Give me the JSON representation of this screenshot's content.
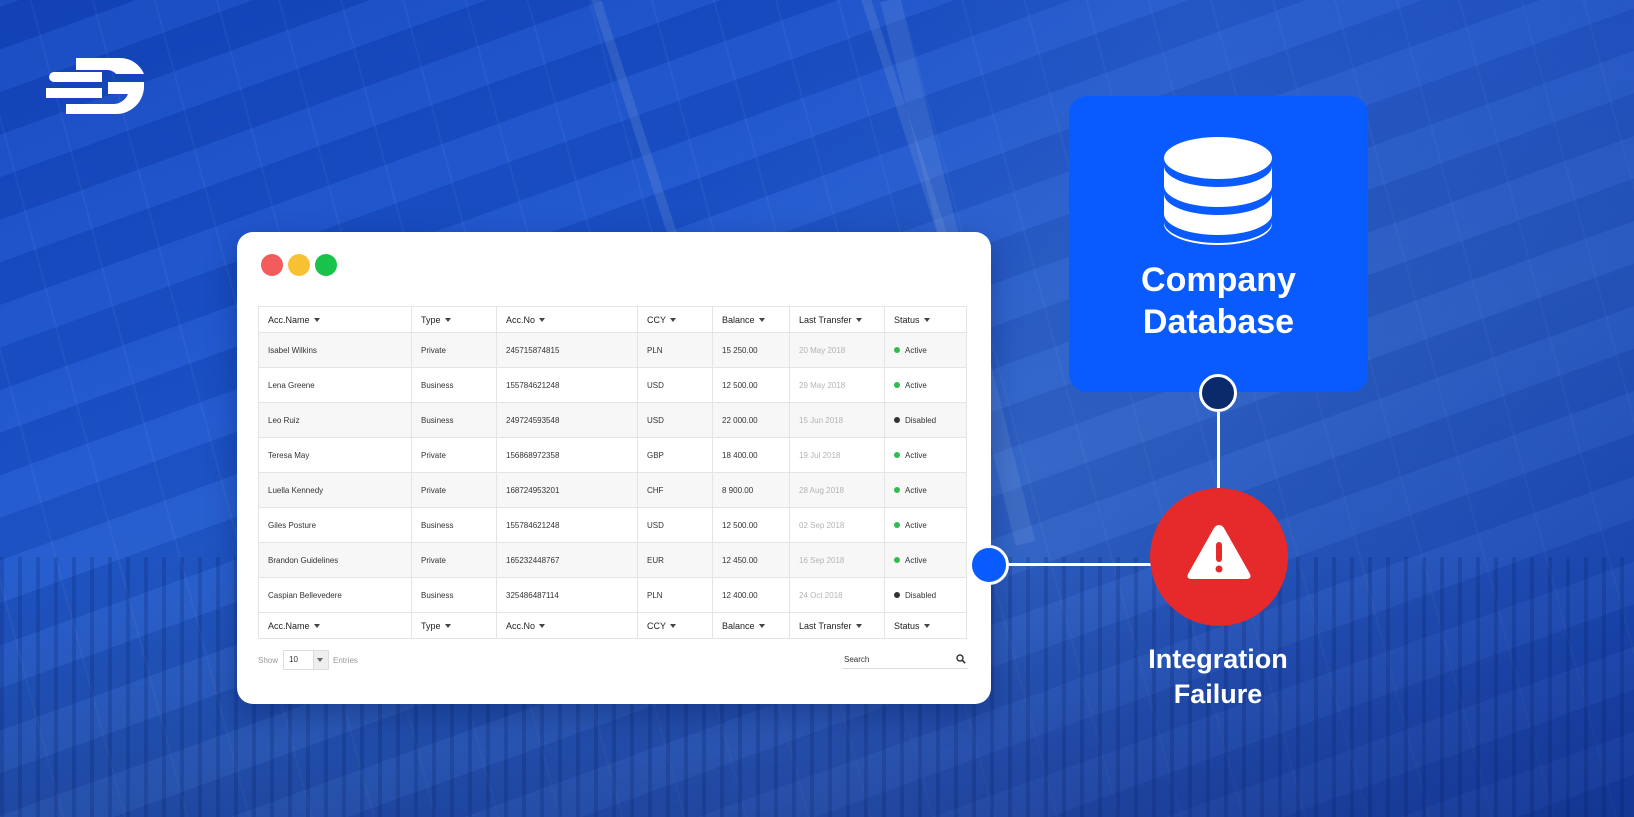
{
  "table": {
    "columns": [
      "Acc.Name",
      "Type",
      "Acc.No",
      "CCY",
      "Balance",
      "Last Transfer",
      "Status"
    ],
    "rows": [
      {
        "name": "Isabel Wilkins",
        "type": "Private",
        "acc_no": "245715874815",
        "ccy": "PLN",
        "balance": "15 250.00",
        "last_transfer": "20 May 2018",
        "status": "Active"
      },
      {
        "name": "Lena Greene",
        "type": "Business",
        "acc_no": "155784621248",
        "ccy": "USD",
        "balance": "12 500.00",
        "last_transfer": "29 May 2018",
        "status": "Active"
      },
      {
        "name": "Leo Ruiz",
        "type": "Business",
        "acc_no": "249724593548",
        "ccy": "USD",
        "balance": "22 000.00",
        "last_transfer": "15 Jun 2018",
        "status": "Disabled"
      },
      {
        "name": "Teresa May",
        "type": "Private",
        "acc_no": "156868972358",
        "ccy": "GBP",
        "balance": "18 400.00",
        "last_transfer": "19 Jul 2018",
        "status": "Active"
      },
      {
        "name": "Luella Kennedy",
        "type": "Private",
        "acc_no": "168724953201",
        "ccy": "CHF",
        "balance": "8 900.00",
        "last_transfer": "28 Aug 2018",
        "status": "Active"
      },
      {
        "name": "Giles Posture",
        "type": "Business",
        "acc_no": "155784621248",
        "ccy": "USD",
        "balance": "12 500.00",
        "last_transfer": "02 Sep 2018",
        "status": "Active"
      },
      {
        "name": "Brandon Guidelines",
        "type": "Private",
        "acc_no": "165232448767",
        "ccy": "EUR",
        "balance": "12 450.00",
        "last_transfer": "16 Sep 2018",
        "status": "Active"
      },
      {
        "name": "Caspian Bellevedere",
        "type": "Business",
        "acc_no": "325486487114",
        "ccy": "PLN",
        "balance": "12 400.00",
        "last_transfer": "24 Oct 2018",
        "status": "Disabled"
      }
    ]
  },
  "footer": {
    "show_label": "Show",
    "entries_value": "10",
    "entries_label": "Entries",
    "search_placeholder": "Search"
  },
  "database_card": {
    "title_line1": "Company",
    "title_line2": "Database"
  },
  "failure": {
    "line1": "Integration",
    "line2": "Failure"
  },
  "colors": {
    "background": "#1a4fc4",
    "database_card": "#0a5bff",
    "failure": "#e6292a",
    "active": "#2fbd4f",
    "disabled": "#333333"
  },
  "icons": [
    "brand-logo-icon",
    "database-icon",
    "warning-icon",
    "search-icon",
    "caret-down-icon"
  ]
}
